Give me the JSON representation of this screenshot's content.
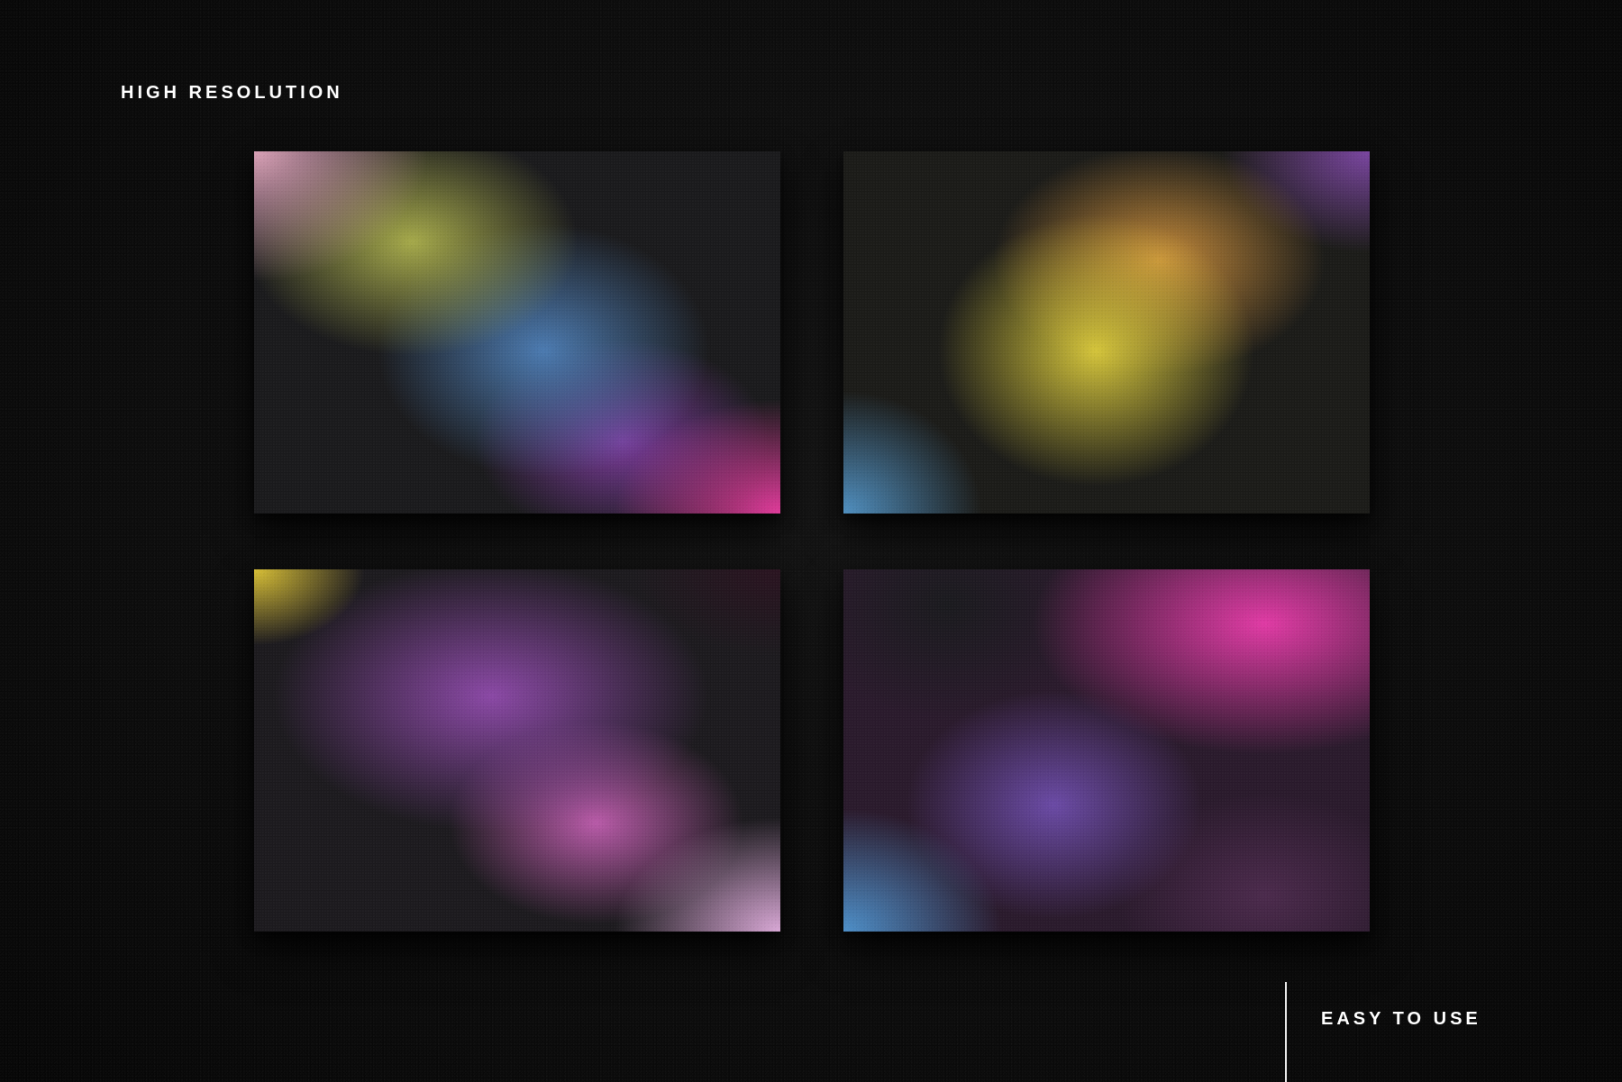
{
  "labels": {
    "top": "HIGH RESOLUTION",
    "bottom": "EASY TO USE"
  },
  "cards": [
    {
      "name": "gradient-card-1",
      "dominant_colors": [
        "#d9a0b6",
        "#a5a94a",
        "#4b7ab0",
        "#e03a9a"
      ]
    },
    {
      "name": "gradient-card-2",
      "dominant_colors": [
        "#d4c43a",
        "#c88c3a",
        "#7a45a0",
        "#4f8fc0"
      ]
    },
    {
      "name": "gradient-card-3",
      "dominant_colors": [
        "#d8bf35",
        "#8a48a5",
        "#b85aa8",
        "#d9a8d6"
      ]
    },
    {
      "name": "gradient-card-4",
      "dominant_colors": [
        "#e03aa4",
        "#6a4aa5",
        "#4d8fc9",
        "#4b2a4c"
      ]
    }
  ],
  "colors": {
    "background": "#0b0b0b",
    "text": "#ffffff",
    "divider": "#e9e9e9"
  }
}
